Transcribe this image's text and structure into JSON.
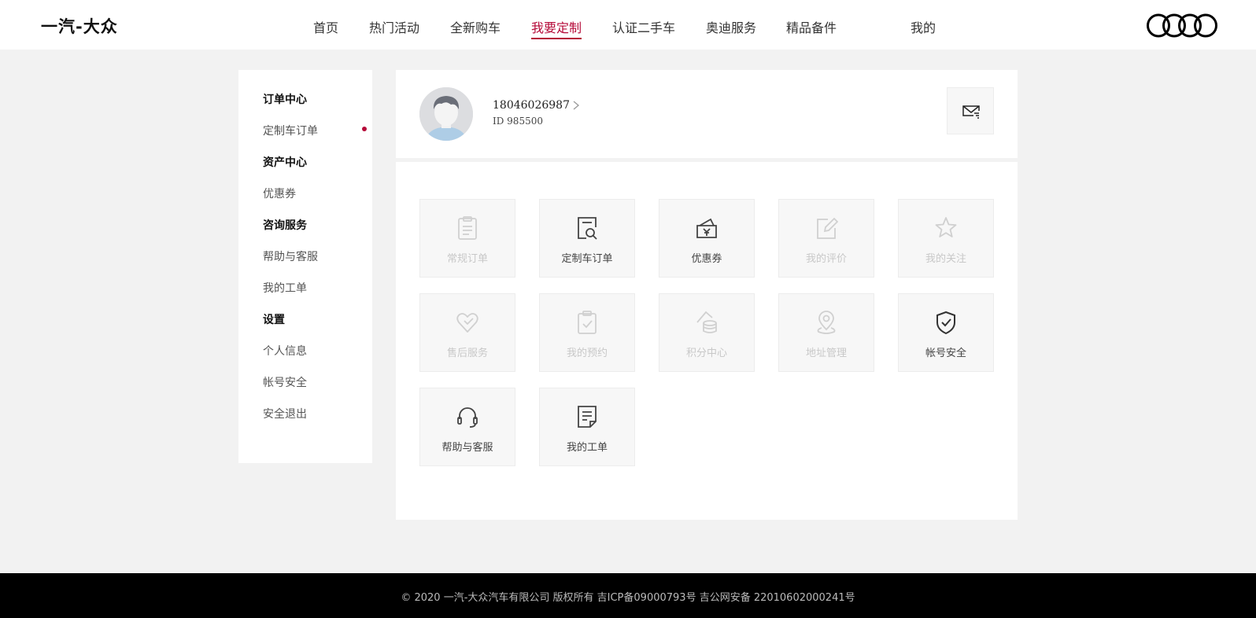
{
  "header": {
    "brand": "一汽-大众",
    "nav": [
      "首页",
      "热门活动",
      "全新购车",
      "我要定制",
      "认证二手车",
      "奥迪服务",
      "精品备件",
      "我的"
    ],
    "active_nav": "我要定制"
  },
  "sidebar": {
    "sections": [
      {
        "title": "订单中心",
        "items": [
          "定制车订单"
        ]
      },
      {
        "title": "资产中心",
        "items": [
          "优惠券"
        ]
      },
      {
        "title": "咨询服务",
        "items": [
          "帮助与客服",
          "我的工单"
        ]
      },
      {
        "title": "设置",
        "items": [
          "个人信息",
          "帐号安全",
          "安全退出"
        ]
      }
    ]
  },
  "profile": {
    "phone": "18046026987",
    "id_text": "ID 985500"
  },
  "tiles": [
    {
      "label": "常规订单",
      "icon": "clipboard-icon",
      "enabled": false
    },
    {
      "label": "定制车订单",
      "icon": "document-search-icon",
      "enabled": true
    },
    {
      "label": "优惠券",
      "icon": "coupon-wallet-icon",
      "enabled": true
    },
    {
      "label": "我的评价",
      "icon": "edit-icon",
      "enabled": false
    },
    {
      "label": "我的关注",
      "icon": "star-icon",
      "enabled": false
    },
    {
      "label": "售后服务",
      "icon": "heart-icon",
      "enabled": false
    },
    {
      "label": "我的预约",
      "icon": "calendar-check-icon",
      "enabled": false
    },
    {
      "label": "积分中心",
      "icon": "coins-icon",
      "enabled": false
    },
    {
      "label": "地址管理",
      "icon": "location-pin-icon",
      "enabled": false
    },
    {
      "label": "帐号安全",
      "icon": "shield-check-icon",
      "enabled": true
    },
    {
      "label": "帮助与客服",
      "icon": "headset-icon",
      "enabled": true
    },
    {
      "label": "我的工单",
      "icon": "work-order-icon",
      "enabled": true
    }
  ],
  "footer": {
    "text": "© 2020 一汽-大众汽车有限公司 版权所有 吉ICP备09000793号 吉公网安备 22010602000241号"
  },
  "colors": {
    "accent": "#b50938",
    "background": "#f2f2f2",
    "footer": "#000000"
  }
}
